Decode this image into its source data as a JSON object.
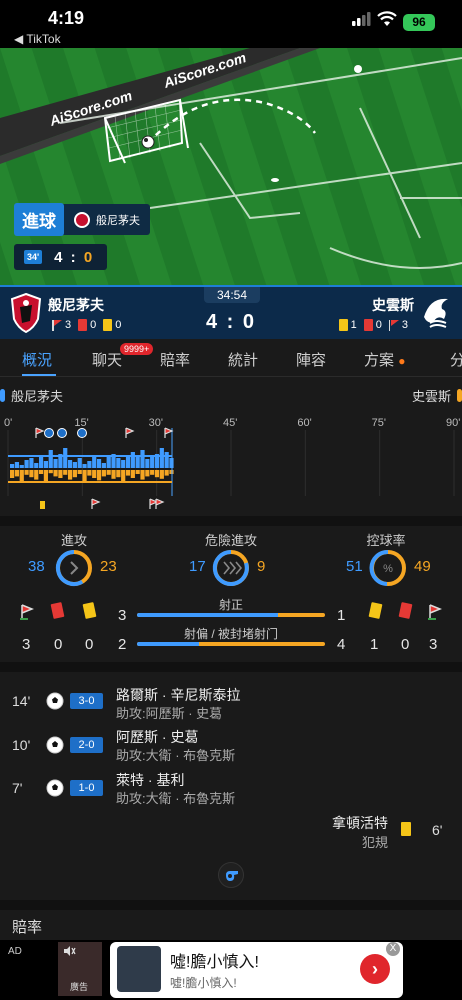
{
  "status_bar": {
    "time": "4:19",
    "back_app": "◀ TikTok",
    "battery": "96"
  },
  "field": {
    "watermark": "AiScore.com",
    "goal_tag": "進球",
    "goal_team": "般尼茅夫",
    "mini_minute": "34'",
    "mini_home": "4",
    "mini_sep": ":",
    "mini_away": "0"
  },
  "match": {
    "home": "般尼茅夫",
    "away": "史雲斯",
    "clock": "34:54",
    "score": "4 : 0",
    "home_counts": {
      "corners": "3",
      "red": "0",
      "yellow": "0"
    },
    "away_counts": {
      "yellow": "1",
      "red": "0",
      "corners": "3"
    }
  },
  "tabs": [
    {
      "label": "概況"
    },
    {
      "label": "聊天"
    },
    {
      "label": "賠率"
    },
    {
      "label": "統計"
    },
    {
      "label": "陣容"
    },
    {
      "label": "方案"
    },
    {
      "label": "分"
    }
  ],
  "chat_badge": "9999+",
  "timeline": {
    "home": "般尼茅夫",
    "away": "史雲斯",
    "ticks": [
      "0'",
      "15'",
      "30'",
      "45'",
      "60'",
      "75'",
      "90'"
    ]
  },
  "stats": {
    "attack": {
      "label": "進攻",
      "home": "38",
      "away": "23"
    },
    "dangerous": {
      "label": "危險進攻",
      "home": "17",
      "away": "9"
    },
    "possession": {
      "label": "控球率",
      "home": "51",
      "away": "49"
    },
    "on_target": {
      "label": "射正",
      "home": "3",
      "away": "1",
      "home_frac": 0.75
    },
    "off_target": {
      "label": "射偏 / 被封堵射门",
      "home": "2",
      "away": "4",
      "home_frac": 0.33
    },
    "home_counts": {
      "corners": "3",
      "red": "0",
      "yellow": "0"
    },
    "away_counts": {
      "yellow": "1",
      "red": "0",
      "corners": "3"
    }
  },
  "events": [
    {
      "minute": "14'",
      "score": "3-0",
      "player": "路爾斯 · 辛尼斯泰拉",
      "assist": "助攻:阿歷斯 · 史葛"
    },
    {
      "minute": "10'",
      "score": "2-0",
      "player": "阿歷斯 · 史葛",
      "assist": "助攻:大衛 · 布魯克斯"
    },
    {
      "minute": "7'",
      "score": "1-0",
      "player": "萊特 · 基利",
      "assist": "助攻:大衛 · 布魯克斯"
    }
  ],
  "away_event": {
    "player": "拿頓活特",
    "reason": "犯規",
    "minute": "6'"
  },
  "odds_title": "賠率",
  "ad": {
    "label": "AD",
    "thumb_label": "廣告",
    "headline": "噓!膽小慎入!",
    "sub": "噓!膽小慎入!",
    "close": "X",
    "go": "›"
  },
  "colors": {
    "home": "#3f9bff",
    "away": "#f5a623",
    "accent": "#1e7fd6"
  }
}
